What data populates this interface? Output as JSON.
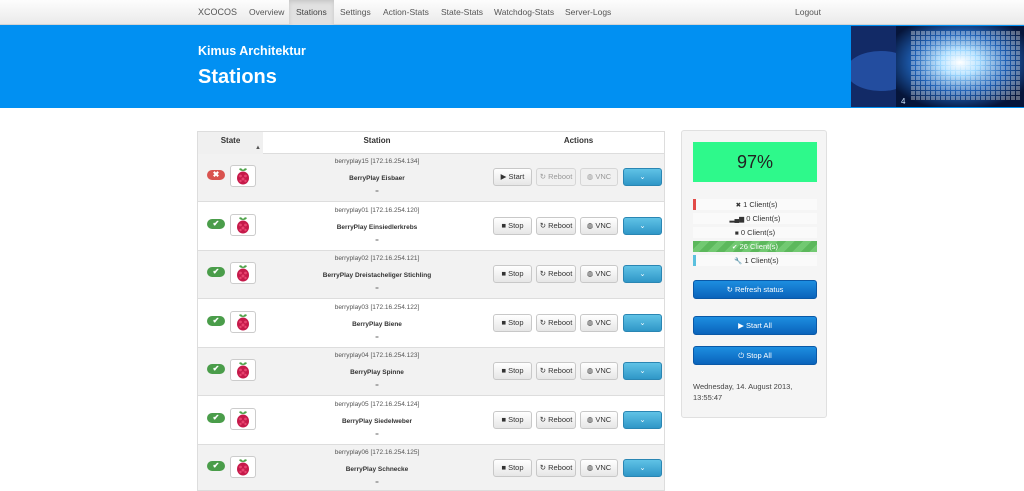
{
  "nav": {
    "brand": "XCOCOS",
    "items": [
      "Overview",
      "Stations",
      "Settings",
      "Action-Stats",
      "State-Stats",
      "Watchdog-Stats",
      "Server-Logs"
    ],
    "logout": "Logout"
  },
  "banner": {
    "org": "Kimus Architektur",
    "title": "Stations"
  },
  "table": {
    "headers": {
      "state": "State",
      "station": "Station",
      "actions": "Actions"
    },
    "rows": [
      {
        "status": "error",
        "ip": "berryplay15 [172.16.254.134]",
        "name": "BerryPlay Eisbaer",
        "handle": "=",
        "toggle": "Start",
        "reboot": "Reboot",
        "vnc": "VNC"
      },
      {
        "status": "ok",
        "ip": "berryplay01 [172.16.254.120]",
        "name": "BerryPlay Einsiedlerkrebs",
        "handle": "=",
        "toggle": "Stop",
        "reboot": "Reboot",
        "vnc": "VNC"
      },
      {
        "status": "ok",
        "ip": "berryplay02 [172.16.254.121]",
        "name": "BerryPlay Dreistacheliger Stichling",
        "handle": "=",
        "toggle": "Stop",
        "reboot": "Reboot",
        "vnc": "VNC"
      },
      {
        "status": "ok",
        "ip": "berryplay03 [172.16.254.122]",
        "name": "BerryPlay Biene",
        "handle": "=",
        "toggle": "Stop",
        "reboot": "Reboot",
        "vnc": "VNC"
      },
      {
        "status": "ok",
        "ip": "berryplay04 [172.16.254.123]",
        "name": "BerryPlay Spinne",
        "handle": "=",
        "toggle": "Stop",
        "reboot": "Reboot",
        "vnc": "VNC"
      },
      {
        "status": "ok",
        "ip": "berryplay05 [172.16.254.124]",
        "name": "BerryPlay Siedelweber",
        "handle": "=",
        "toggle": "Stop",
        "reboot": "Reboot",
        "vnc": "VNC"
      },
      {
        "status": "ok",
        "ip": "berryplay06 [172.16.254.125]",
        "name": "BerryPlay Schnecke",
        "handle": "=",
        "toggle": "Stop",
        "reboot": "Reboot",
        "vnc": "VNC"
      }
    ]
  },
  "panel": {
    "percent": "97%",
    "stats": [
      {
        "icon": "✖",
        "text": "1 Client(s)",
        "color": "#e24b48"
      },
      {
        "icon": "▂▄▆",
        "text": "0 Client(s)",
        "color": "#999999"
      },
      {
        "icon": "■",
        "text": "0 Client(s)",
        "color": "#999999"
      },
      {
        "icon": "✔",
        "text": "26 Client(s)",
        "color": "#5cb85c"
      },
      {
        "icon": "🔧",
        "text": "1 Client(s)",
        "color": "#5bc0de"
      }
    ],
    "refresh": "Refresh status",
    "start_all": "Start All",
    "stop_all": "Stop All",
    "date": "Wednesday, 14. August 2013,",
    "time": "13:55:47"
  }
}
